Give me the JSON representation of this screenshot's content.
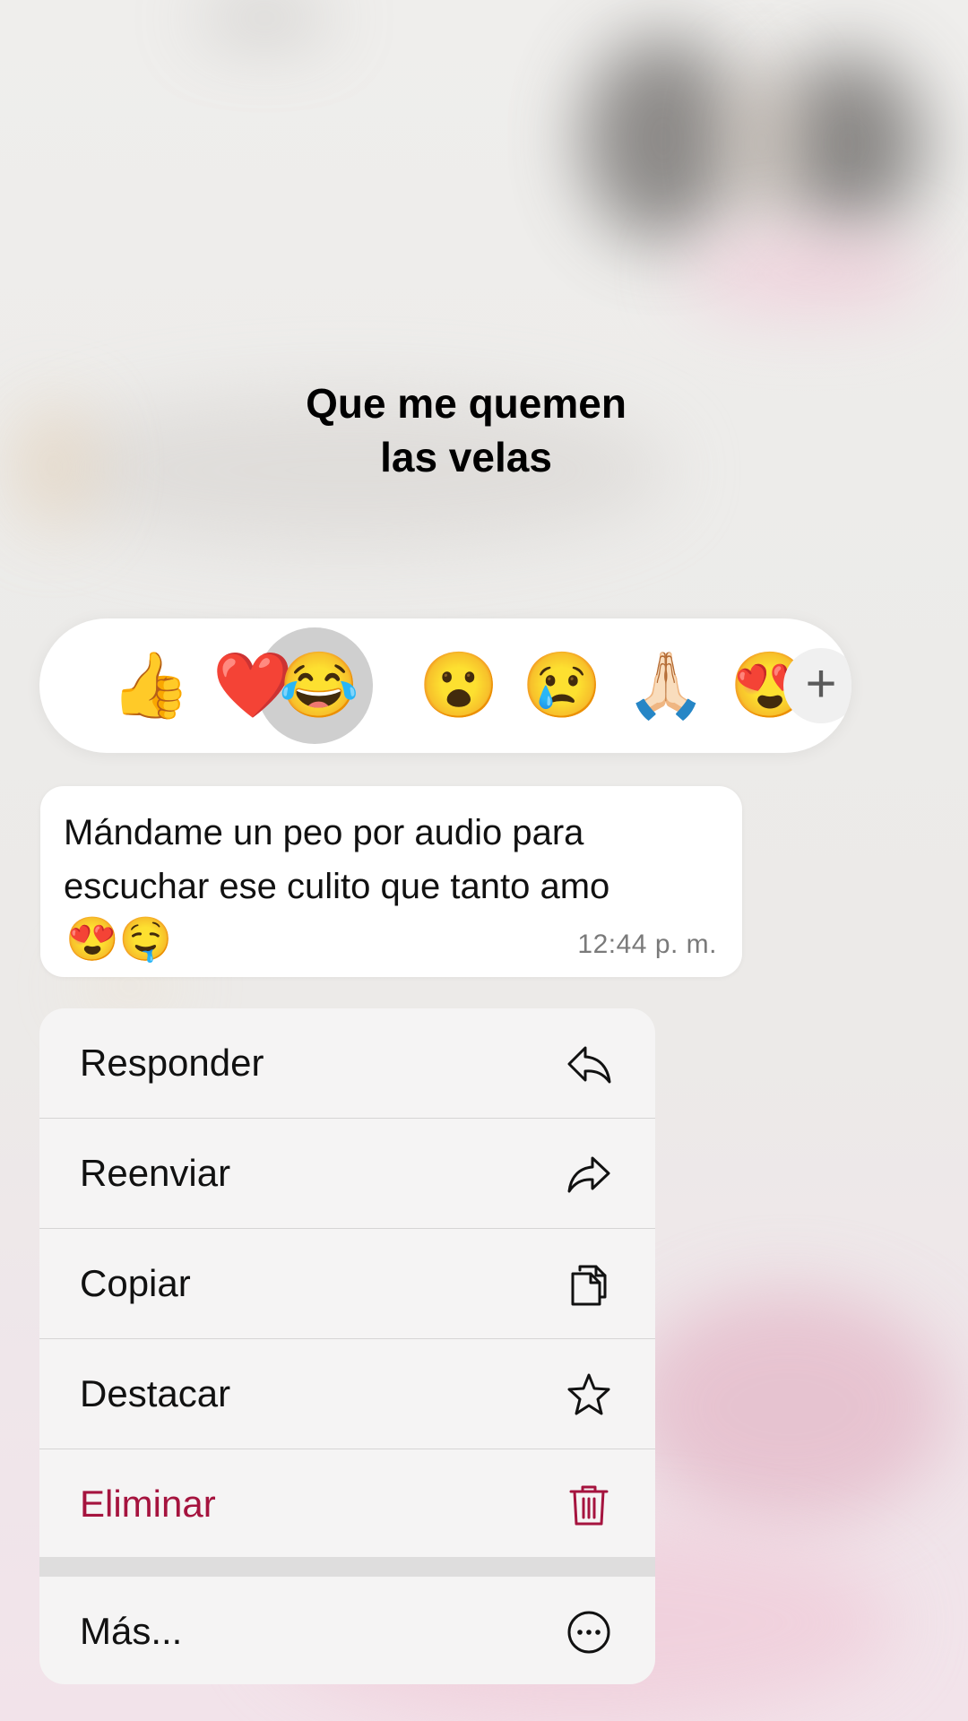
{
  "background": {
    "chat_title_line1": "Que me quemen",
    "chat_title_line2": "las velas"
  },
  "reactions": {
    "items": [
      {
        "name": "thumbs-up",
        "glyph": "👍"
      },
      {
        "name": "red-heart",
        "glyph": "❤️"
      },
      {
        "name": "tears-of-joy",
        "glyph": "😂",
        "selected": true
      },
      {
        "name": "surprised",
        "glyph": "😮"
      },
      {
        "name": "crying",
        "glyph": "😢"
      },
      {
        "name": "folded-hands",
        "glyph": "🙏🏻"
      },
      {
        "name": "heart-eyes-partial",
        "glyph": "😍"
      }
    ],
    "more_glyph": "+"
  },
  "message": {
    "text": "Mándame un peo por audio para escuchar ese culito que tanto amo",
    "emojis": "😍🤤",
    "time": "12:44 p. m."
  },
  "menu": {
    "items": [
      {
        "label": "Responder",
        "icon": "reply-icon"
      },
      {
        "label": "Reenviar",
        "icon": "forward-icon"
      },
      {
        "label": "Copiar",
        "icon": "copy-icon"
      },
      {
        "label": "Destacar",
        "icon": "star-icon"
      },
      {
        "label": "Eliminar",
        "icon": "trash-icon",
        "destructive": true
      },
      {
        "label": "Más...",
        "icon": "more-icon"
      }
    ]
  },
  "colors": {
    "destructive": "#a5133e",
    "menu_background": "#f5f4f4",
    "bubble_background": "#ffffff"
  }
}
